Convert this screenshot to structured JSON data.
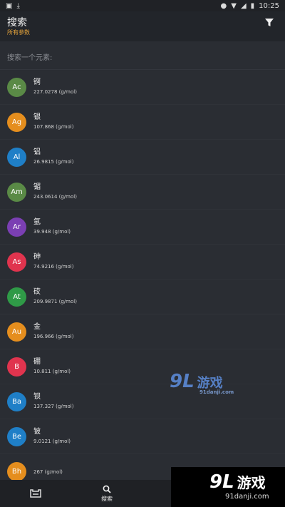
{
  "status_bar": {
    "time": "10:25"
  },
  "app_bar": {
    "title": "搜索",
    "subtitle": "所有参数"
  },
  "search": {
    "placeholder": "搜索一个元素:"
  },
  "elements": [
    {
      "symbol": "Ac",
      "name": "锕",
      "mass": "227.0278 (g/mol)",
      "color": "#5a8a46"
    },
    {
      "symbol": "Ag",
      "name": "银",
      "mass": "107.868 (g/mol)",
      "color": "#e58e1e"
    },
    {
      "symbol": "Al",
      "name": "铝",
      "mass": "26.9815 (g/mol)",
      "color": "#1f7fc7"
    },
    {
      "symbol": "Am",
      "name": "镅",
      "mass": "243.0614 (g/mol)",
      "color": "#5a8a46"
    },
    {
      "symbol": "Ar",
      "name": "氩",
      "mass": "39.948 (g/mol)",
      "color": "#7b3fb3"
    },
    {
      "symbol": "As",
      "name": "砷",
      "mass": "74.9216 (g/mol)",
      "color": "#e0344e"
    },
    {
      "symbol": "At",
      "name": "砹",
      "mass": "209.9871 (g/mol)",
      "color": "#2f9a47"
    },
    {
      "symbol": "Au",
      "name": "金",
      "mass": "196.966 (g/mol)",
      "color": "#e58e1e"
    },
    {
      "symbol": "B",
      "name": "硼",
      "mass": "10.811 (g/mol)",
      "color": "#e0344e"
    },
    {
      "symbol": "Ba",
      "name": "钡",
      "mass": "137.327 (g/mol)",
      "color": "#1f7fc7"
    },
    {
      "symbol": "Be",
      "name": "铍",
      "mass": "9.0121 (g/mol)",
      "color": "#1f7fc7"
    },
    {
      "symbol": "Bh",
      "name": "",
      "mass": "267 (g/mol)",
      "color": "#e58e1e"
    }
  ],
  "bottom_nav": {
    "items": [
      {
        "icon": "table-icon",
        "label": ""
      },
      {
        "icon": "search-icon",
        "label": "搜索"
      },
      {
        "icon": "list-icon",
        "label": ""
      }
    ]
  },
  "watermarks": {
    "center": {
      "logo": "9L",
      "text": "游戏",
      "sub": "91danji.com"
    },
    "corner": {
      "logo": "9L",
      "text": "游戏",
      "sub": "91danji.com"
    }
  }
}
